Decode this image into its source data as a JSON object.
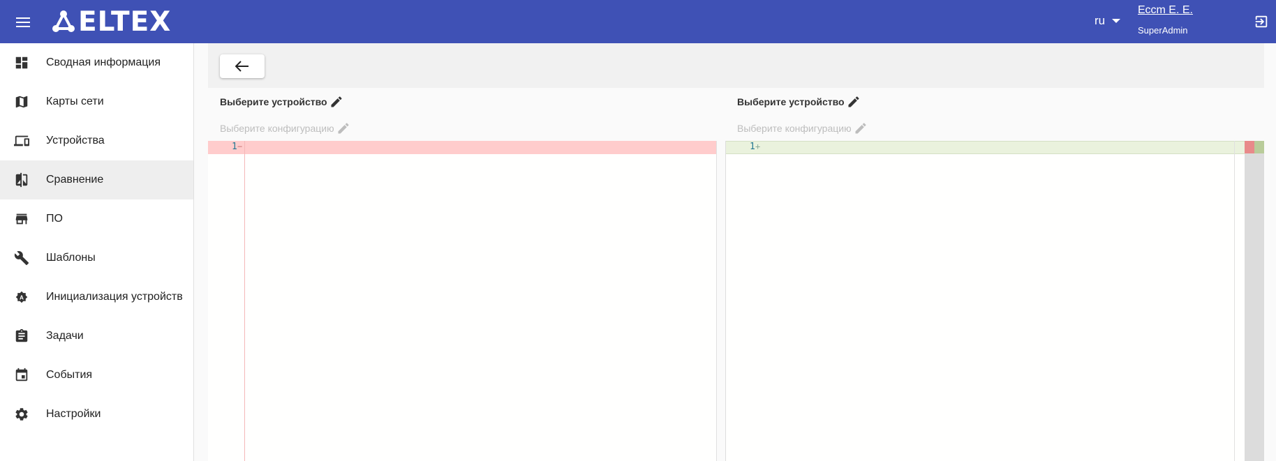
{
  "header": {
    "logo_text": "ELTEX",
    "lang": "ru",
    "user_name": "Ессm Е. Е.",
    "user_role": "SuperAdmin",
    "bg_color": "#3f51b5"
  },
  "sidebar": {
    "items": [
      {
        "label": "Сводная информация",
        "icon": "dashboard-icon"
      },
      {
        "label": "Карты сети",
        "icon": "map-icon"
      },
      {
        "label": "Устройства",
        "icon": "devices-icon"
      },
      {
        "label": "Сравнение",
        "icon": "compare-icon",
        "active": true
      },
      {
        "label": "ПО",
        "icon": "store-icon"
      },
      {
        "label": "Шаблоны",
        "icon": "wrench-icon"
      },
      {
        "label": "Инициализация устройств",
        "icon": "auto-badge-icon"
      },
      {
        "label": "Задачи",
        "icon": "assignment-icon"
      },
      {
        "label": "События",
        "icon": "calendar-icon"
      },
      {
        "label": "Настройки",
        "icon": "gear-icon"
      }
    ]
  },
  "compare": {
    "left": {
      "device_label": "Выберите устройство",
      "config_label": "Выберите конфигурацию",
      "line_number": "1",
      "marker": "−"
    },
    "right": {
      "device_label": "Выберите устройство",
      "config_label": "Выберите конфигурацию",
      "line_number": "1",
      "marker": "+"
    }
  },
  "colors": {
    "deleted": "#ffcccc",
    "added": "#eaf2dd"
  }
}
